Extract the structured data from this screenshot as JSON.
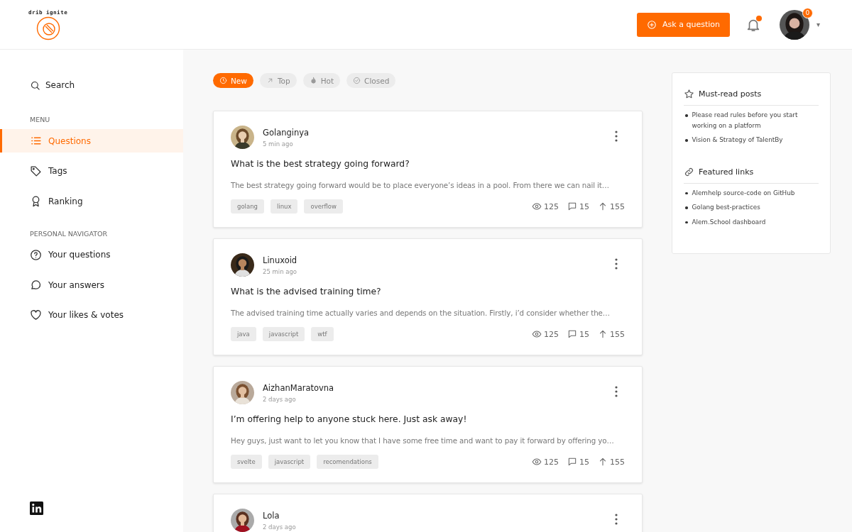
{
  "header": {
    "logo_text": "drib ignite",
    "ask_button": "Ask a question",
    "notifications_unread": true,
    "avatar_badge": "0",
    "menu_caret": "▾"
  },
  "sidebar": {
    "search": "Search",
    "menu_heading": "MENU",
    "menu_items": [
      {
        "label": "Questions",
        "selected": true
      },
      {
        "label": "Tags",
        "selected": false
      },
      {
        "label": "Ranking",
        "selected": false
      }
    ],
    "personal_heading": "PERSONAL NAVIGATOR",
    "personal_items": [
      {
        "label": "Your questions",
        "selected": false
      },
      {
        "label": "Your answers",
        "selected": false
      },
      {
        "label": "Your likes & votes",
        "selected": false
      }
    ]
  },
  "filters": [
    {
      "label": "New",
      "selected": true
    },
    {
      "label": "Top",
      "selected": false
    },
    {
      "label": "Hot",
      "selected": false
    },
    {
      "label": "Closed",
      "selected": false
    }
  ],
  "posts": [
    {
      "author": "Golanginya",
      "time": "5 min ago",
      "title": "What is the best strategy going forward?",
      "excerpt": "The best strategy going forward would be to place everyone’s ideas in a pool. From there we can nail it…",
      "tags": [
        "golang",
        "linux",
        "overflow"
      ],
      "views": "125",
      "comments": "15",
      "votes": "155"
    },
    {
      "author": "Linuxoid",
      "time": "25 min ago",
      "title": "What is the advised training time?",
      "excerpt": "The advised training time actually varies and depends on the situation. Firstly, i’d consider whether the…",
      "tags": [
        "java",
        "javascript",
        "wtf"
      ],
      "views": "125",
      "comments": "15",
      "votes": "155"
    },
    {
      "author": "AizhanMaratovna",
      "time": "2 days ago",
      "title": "I’m offering help to anyone stuck here. Just ask away!",
      "excerpt": "Hey guys, just want to let you know that I have some free time and want to pay it forward by offering yo…",
      "tags": [
        "svelte",
        "javascript",
        "recomendations"
      ],
      "views": "125",
      "comments": "15",
      "votes": "155"
    },
    {
      "author": "Lola",
      "time": "2 days ago"
    }
  ],
  "panel": [
    {
      "title": "Must-read posts",
      "links": [
        "Please read rules before you start working on a platform",
        "Vision & Strategy of TalentBy"
      ]
    },
    {
      "title": "Featured links",
      "links": [
        "Alemhelp source-code on GitHub",
        "Golang best-practices",
        "Alem.School dashboard"
      ]
    }
  ]
}
